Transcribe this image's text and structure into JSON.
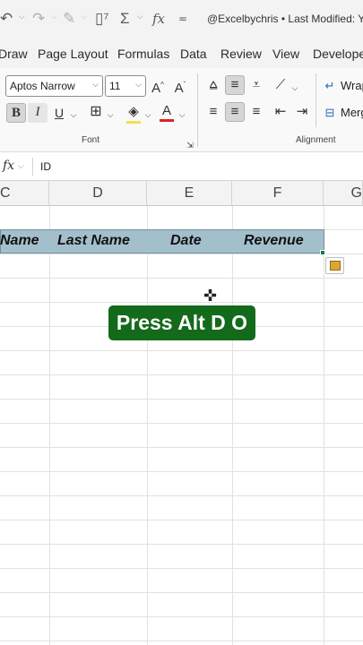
{
  "qat": {
    "title": "@Excelbychris • Last Modified: Yes"
  },
  "ribbon_tabs": [
    "Draw",
    "Page Layout",
    "Formulas",
    "Data",
    "Review",
    "View",
    "Developer"
  ],
  "ribbon": {
    "font_name": "Aptos Narrow",
    "font_size": "11",
    "font_group_label": "Font",
    "alignment_group_label": "Alignment",
    "wrap_label": "Wrap",
    "merge_label": "Merg"
  },
  "formula_bar": {
    "fx_label": "fx",
    "value": "ID"
  },
  "columns": [
    "C",
    "D",
    "E",
    "F",
    "G"
  ],
  "header_row": {
    "cells": [
      "Name",
      "Last Name",
      "Date",
      "Revenue"
    ]
  },
  "banner": {
    "text": "Press Alt D O",
    "color": "#136a1a"
  },
  "colors": {
    "excel_green": "#107c41",
    "header_fill": "#a3bfcc"
  }
}
